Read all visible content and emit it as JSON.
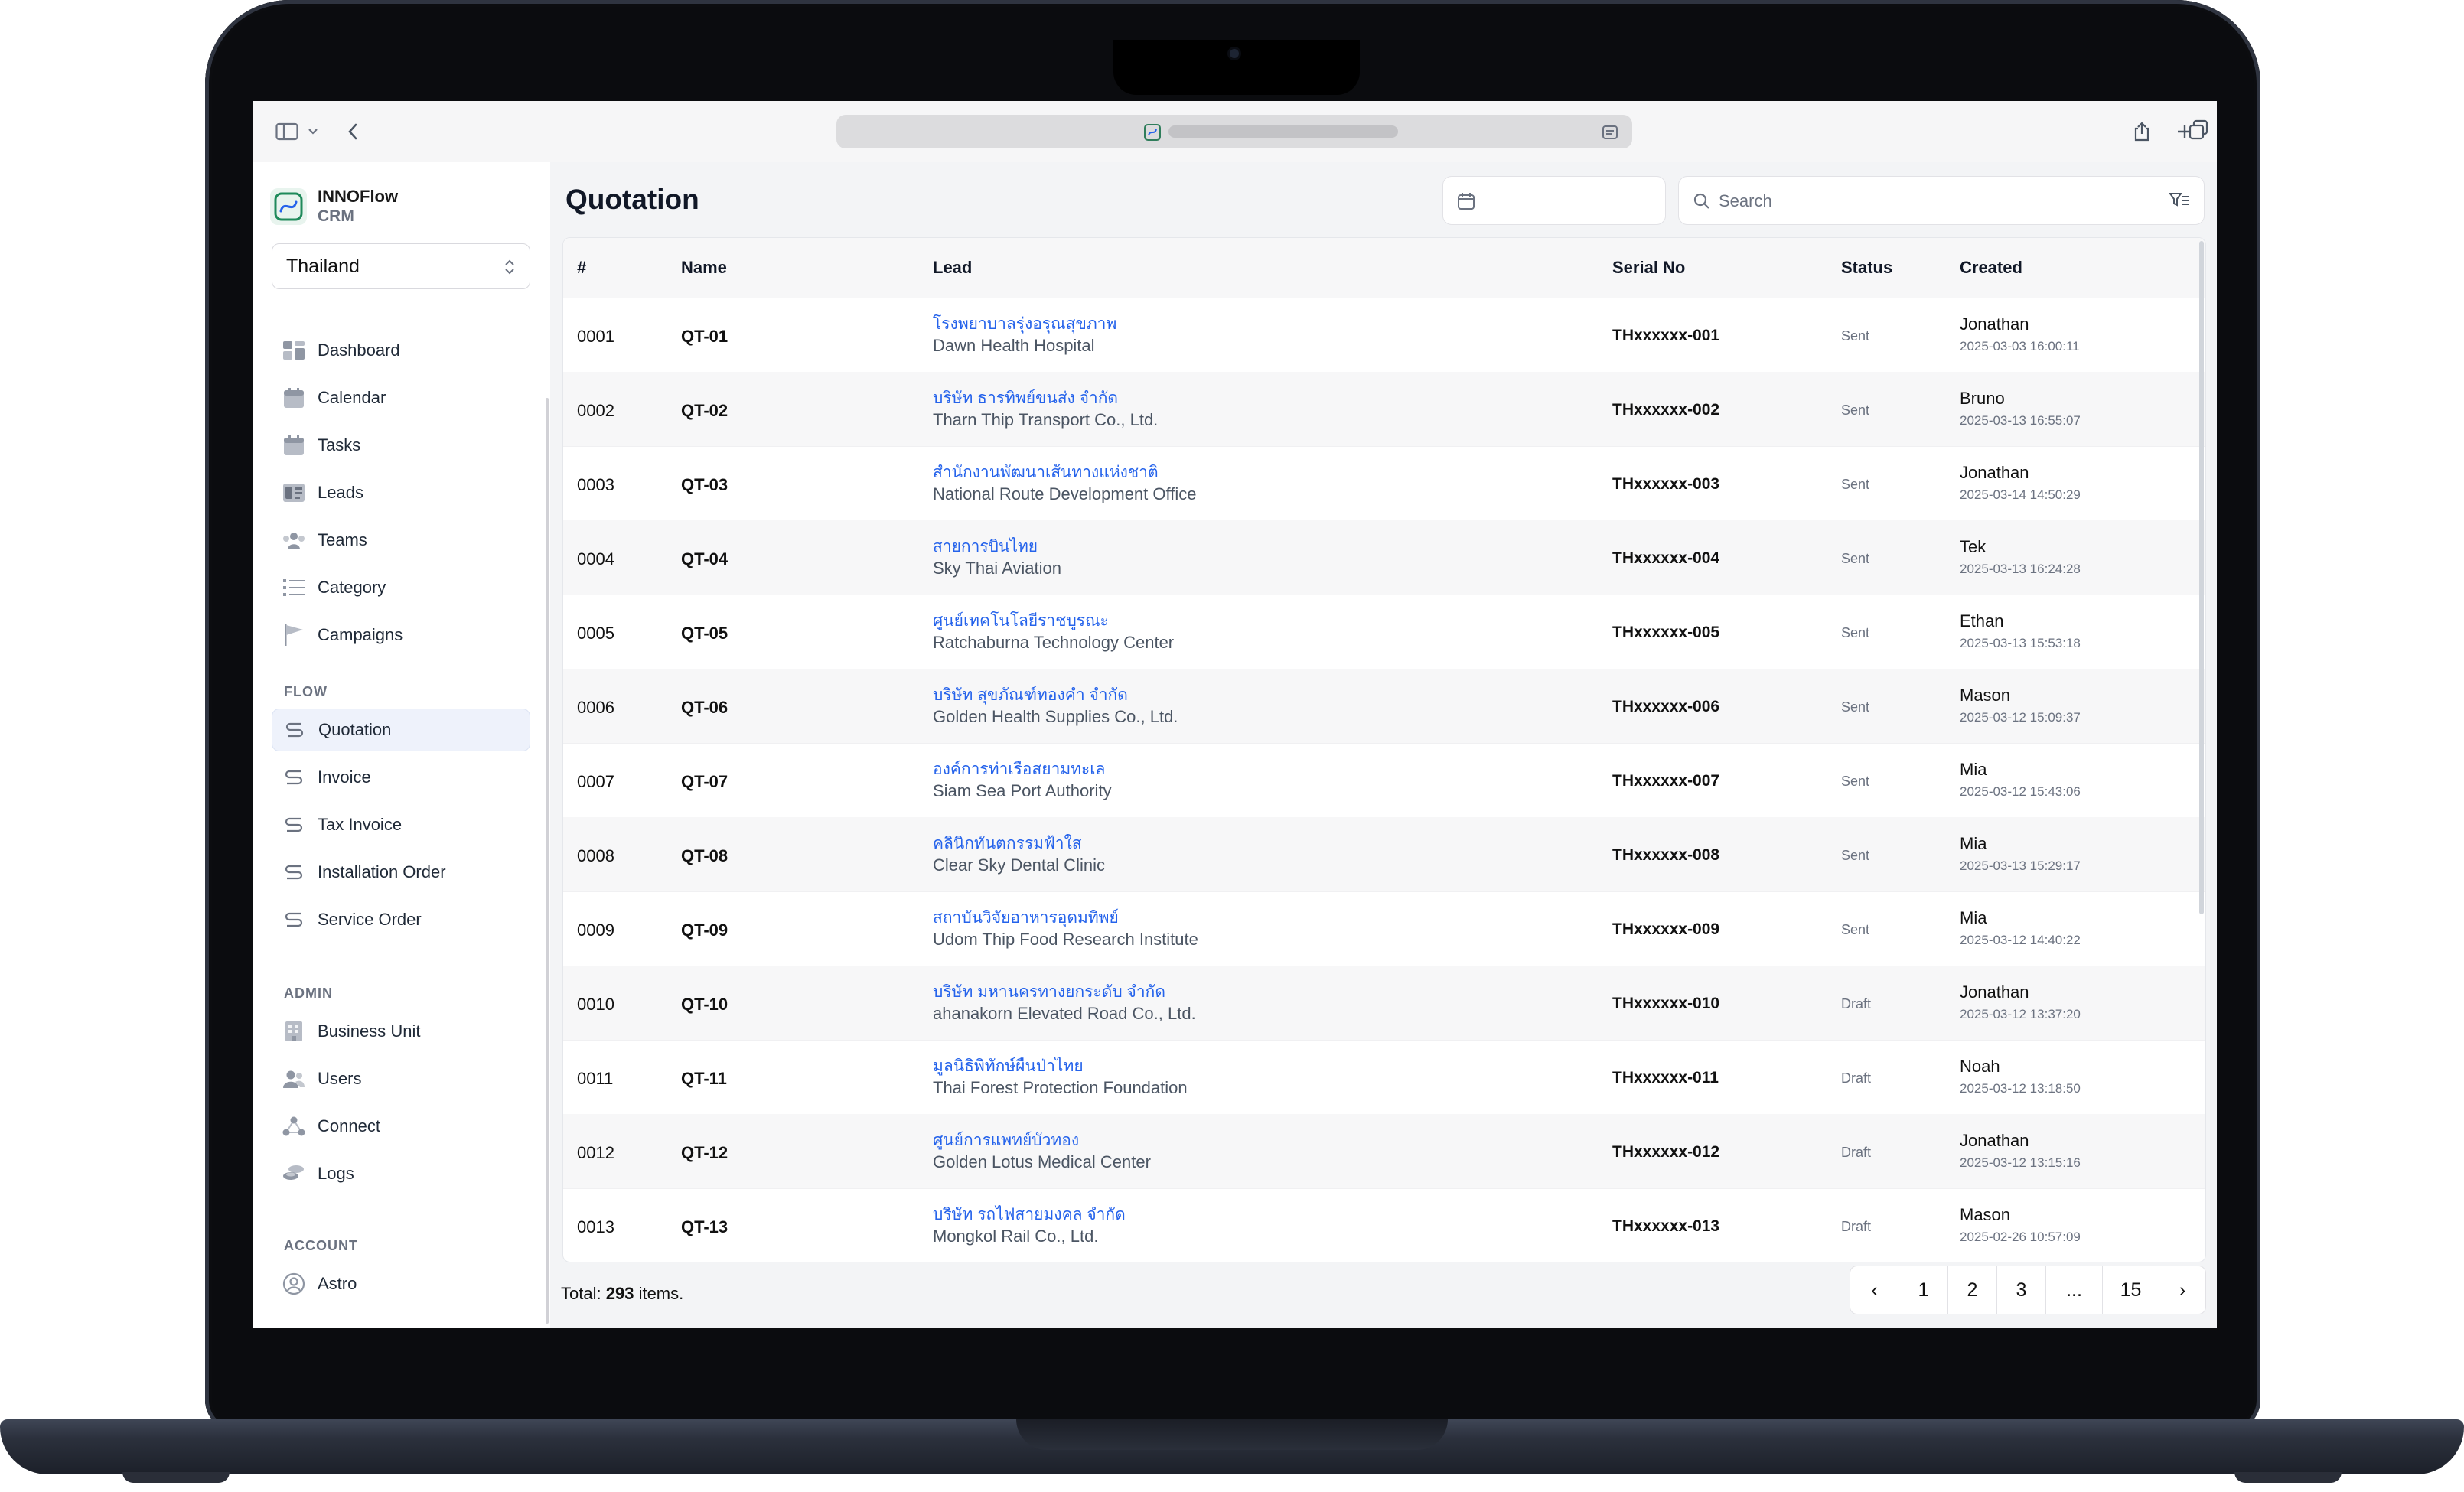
{
  "sidebar": {
    "brand_name": "INNOFlow",
    "brand_sub": "CRM",
    "country": "Thailand",
    "items": [
      {
        "label": "Dashboard",
        "icon": "dashboard-icon"
      },
      {
        "label": "Calendar",
        "icon": "calendar-icon"
      },
      {
        "label": "Tasks",
        "icon": "tasks-icon"
      },
      {
        "label": "Leads",
        "icon": "leads-icon"
      },
      {
        "label": "Teams",
        "icon": "teams-icon"
      },
      {
        "label": "Category",
        "icon": "category-icon"
      },
      {
        "label": "Campaigns",
        "icon": "flag-icon"
      }
    ],
    "flow_label": "FLOW",
    "flow_items": [
      {
        "label": "Quotation",
        "active": true
      },
      {
        "label": "Invoice"
      },
      {
        "label": "Tax Invoice"
      },
      {
        "label": "Installation Order"
      },
      {
        "label": "Service Order"
      }
    ],
    "admin_label": "ADMIN",
    "admin_items": [
      {
        "label": "Business Unit",
        "icon": "building-icon"
      },
      {
        "label": "Users",
        "icon": "users-icon"
      },
      {
        "label": "Connect",
        "icon": "connect-icon"
      },
      {
        "label": "Logs",
        "icon": "logs-icon"
      }
    ],
    "account_label": "ACCOUNT",
    "account_items": [
      {
        "label": "Astro",
        "icon": "user-circle-icon"
      }
    ]
  },
  "header": {
    "title": "Quotation",
    "search_placeholder": "Search"
  },
  "table": {
    "columns": [
      "#",
      "Name",
      "Lead",
      "Serial No",
      "Status",
      "Created"
    ],
    "rows": [
      {
        "id": "0001",
        "name": "QT-01",
        "lead_th": "โรงพยาบาลรุ่งอรุณสุขภาพ",
        "lead_en": "Dawn Health Hospital",
        "serial": "THxxxxxx-001",
        "status": "Sent",
        "user": "Jonathan",
        "created": "2025-03-03 16:00:11"
      },
      {
        "id": "0002",
        "name": "QT-02",
        "lead_th": "บริษัท ธารทิพย์ขนส่ง จำกัด",
        "lead_en": "Tharn Thip Transport Co., Ltd.",
        "serial": "THxxxxxx-002",
        "status": "Sent",
        "user": "Bruno",
        "created": "2025-03-13 16:55:07"
      },
      {
        "id": "0003",
        "name": "QT-03",
        "lead_th": "สำนักงานพัฒนาเส้นทางแห่งชาติ",
        "lead_en": "National Route Development Office",
        "serial": "THxxxxxx-003",
        "status": "Sent",
        "user": "Jonathan",
        "created": "2025-03-14 14:50:29"
      },
      {
        "id": "0004",
        "name": "QT-04",
        "lead_th": "สายการบินไทย",
        "lead_en": "Sky Thai Aviation",
        "serial": "THxxxxxx-004",
        "status": "Sent",
        "user": "Tek",
        "created": "2025-03-13 16:24:28"
      },
      {
        "id": "0005",
        "name": "QT-05",
        "lead_th": "ศูนย์เทคโนโลยีราชบูรณะ",
        "lead_en": "Ratchaburna Technology Center",
        "serial": "THxxxxxx-005",
        "status": "Sent",
        "user": "Ethan",
        "created": "2025-03-13 15:53:18"
      },
      {
        "id": "0006",
        "name": "QT-06",
        "lead_th": "บริษัท สุขภัณฑ์ทองคำ จำกัด",
        "lead_en": "Golden Health Supplies Co., Ltd.",
        "serial": "THxxxxxx-006",
        "status": "Sent",
        "user": "Mason",
        "created": "2025-03-12 15:09:37"
      },
      {
        "id": "0007",
        "name": "QT-07",
        "lead_th": "องค์การท่าเรือสยามทะเล",
        "lead_en": "Siam Sea Port Authority",
        "serial": "THxxxxxx-007",
        "status": "Sent",
        "user": "Mia",
        "created": "2025-03-12 15:43:06"
      },
      {
        "id": "0008",
        "name": "QT-08",
        "lead_th": "คลินิกทันตกรรมฟ้าใส",
        "lead_en": "Clear Sky Dental Clinic",
        "serial": "THxxxxxx-008",
        "status": "Sent",
        "user": "Mia",
        "created": "2025-03-13 15:29:17"
      },
      {
        "id": "0009",
        "name": "QT-09",
        "lead_th": "สถาบันวิจัยอาหารอุดมทิพย์",
        "lead_en": "Udom Thip Food Research Institute",
        "serial": "THxxxxxx-009",
        "status": "Sent",
        "user": "Mia",
        "created": "2025-03-12 14:40:22"
      },
      {
        "id": "0010",
        "name": "QT-10",
        "lead_th": "บริษัท มหานครทางยกระดับ จำกัด",
        "lead_en": "ahanakorn Elevated Road Co., Ltd.",
        "serial": "THxxxxxx-010",
        "status": "Draft",
        "user": "Jonathan",
        "created": "2025-03-12 13:37:20"
      },
      {
        "id": "0011",
        "name": "QT-11",
        "lead_th": "มูลนิธิพิทักษ์ผืนป่าไทย",
        "lead_en": "Thai Forest Protection Foundation",
        "serial": "THxxxxxx-011",
        "status": "Draft",
        "user": "Noah",
        "created": "2025-03-12 13:18:50"
      },
      {
        "id": "0012",
        "name": "QT-12",
        "lead_th": "ศูนย์การแพทย์บัวทอง",
        "lead_en": "Golden Lotus Medical Center",
        "serial": "THxxxxxx-012",
        "status": "Draft",
        "user": "Jonathan",
        "created": "2025-03-12 13:15:16"
      },
      {
        "id": "0013",
        "name": "QT-13",
        "lead_th": "บริษัท รถไฟสายมงคล จำกัด",
        "lead_en": "Mongkol Rail Co., Ltd.",
        "serial": "THxxxxxx-013",
        "status": "Draft",
        "user": "Mason",
        "created": "2025-02-26 10:57:09"
      }
    ]
  },
  "footer": {
    "total_prefix": "Total:",
    "total_count": "293",
    "total_suffix": "items."
  },
  "pagination": {
    "prev": "‹",
    "pages": [
      "1",
      "2",
      "3",
      "...",
      "15"
    ],
    "next": "›"
  },
  "colors": {
    "link": "#2563eb",
    "brand": "#1f8a5b",
    "active_bg": "#eef2fb"
  }
}
